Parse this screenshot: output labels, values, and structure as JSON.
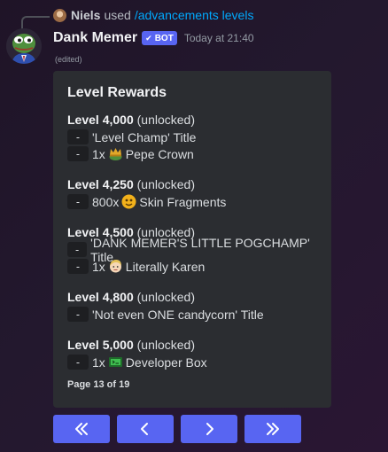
{
  "reply": {
    "username": "Niels",
    "used_text": "used",
    "command": "/advancements levels"
  },
  "message": {
    "author": "Dank Memer",
    "bot_tag": "BOT",
    "timestamp": "Today at 21:40",
    "edited": "(edited)"
  },
  "embed": {
    "title": "Level Rewards",
    "levels": [
      {
        "level": "Level 4,000",
        "status": "(unlocked)",
        "rewards": [
          {
            "bullet": "-",
            "text": "'Level Champ' Title"
          },
          {
            "bullet": "-",
            "prefix": "1x",
            "icon": "crown-emoji-icon",
            "text": "Pepe Crown"
          }
        ]
      },
      {
        "level": "Level 4,250",
        "status": "(unlocked)",
        "rewards": [
          {
            "bullet": "-",
            "prefix": "800x",
            "icon": "theater-mask-emoji-icon",
            "text": "Skin Fragments"
          }
        ]
      },
      {
        "level": "Level 4,500",
        "status": "(unlocked)",
        "rewards": [
          {
            "bullet": "-",
            "text": "'DANK MEMER'S LITTLE POGCHAMP' Title"
          },
          {
            "bullet": "-",
            "prefix": "1x",
            "icon": "karen-emoji-icon",
            "text": "Literally Karen"
          }
        ]
      },
      {
        "level": "Level 4,800",
        "status": "(unlocked)",
        "rewards": [
          {
            "bullet": "-",
            "text": "'Not even ONE candycorn' Title"
          }
        ]
      },
      {
        "level": "Level 5,000",
        "status": "(unlocked)",
        "rewards": [
          {
            "bullet": "-",
            "prefix": "1x",
            "icon": "developer-box-emoji-icon",
            "text": "Developer Box"
          }
        ]
      }
    ],
    "footer": "Page 13 of 19"
  },
  "buttons": [
    {
      "name": "first-page-button",
      "icon": "double-chevron-left-icon"
    },
    {
      "name": "previous-page-button",
      "icon": "chevron-left-icon"
    },
    {
      "name": "next-page-button",
      "icon": "chevron-right-icon"
    },
    {
      "name": "last-page-button",
      "icon": "double-chevron-right-icon"
    }
  ],
  "colors": {
    "accent": "#5865f2",
    "embed_bg": "#2b2d31",
    "link": "#00a8fc"
  }
}
